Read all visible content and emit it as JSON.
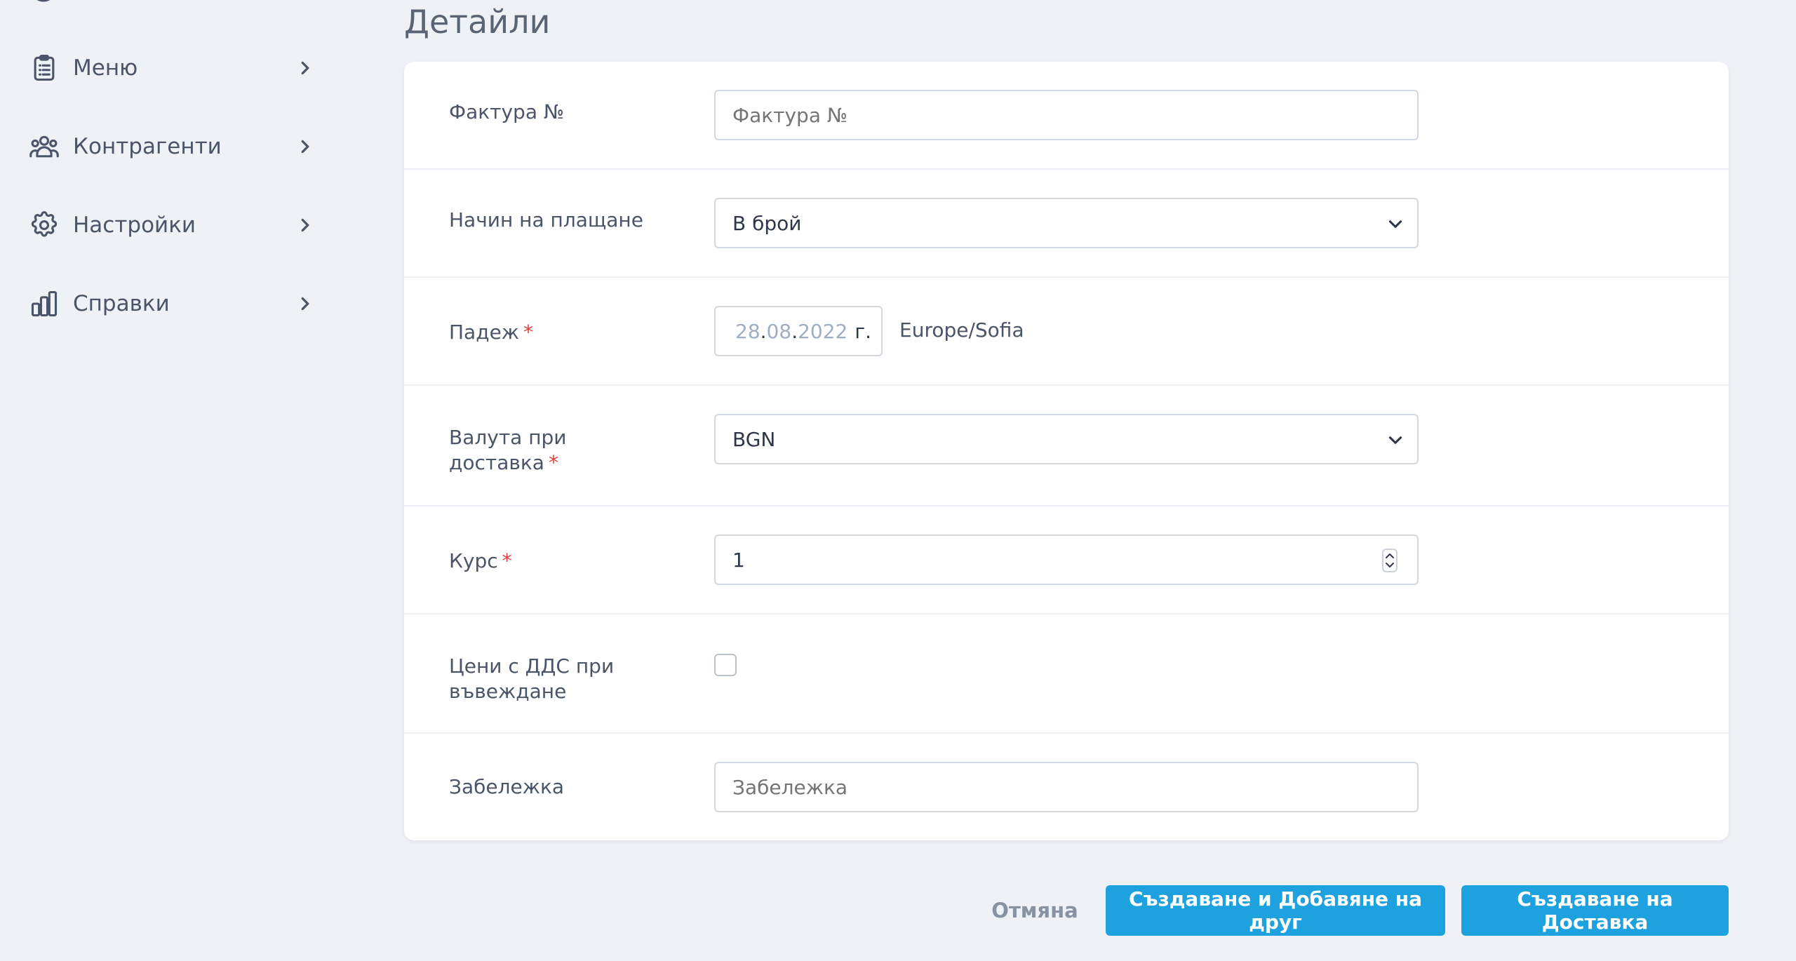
{
  "sidebar": {
    "items": [
      {
        "label": "Меню",
        "icon": "clipboard-list-icon"
      },
      {
        "label": "Контрагенти",
        "icon": "users-icon"
      },
      {
        "label": "Настройки",
        "icon": "gear-icon"
      },
      {
        "label": "Справки",
        "icon": "bar-chart-icon"
      }
    ]
  },
  "page": {
    "title": "Детайли"
  },
  "form": {
    "invoice": {
      "label": "Фактура №",
      "placeholder": "Фактура №",
      "value": ""
    },
    "payment_method": {
      "label": "Начин на плащане",
      "value": "В брой"
    },
    "due_date": {
      "label": "Падеж",
      "required": "*",
      "day": "28",
      "month": "08",
      "year": "2022",
      "suffix": "г.",
      "sep": ".",
      "timezone": "Europe/Sofia"
    },
    "currency": {
      "label_line1": "Валута при",
      "label_line2": "доставка",
      "required": "*",
      "value": "BGN"
    },
    "rate": {
      "label": "Курс",
      "required": "*",
      "value": "1"
    },
    "prices_vat": {
      "label_line1": "Цени с ДДС при",
      "label_line2": "въвеждане",
      "checked": false
    },
    "note": {
      "label": "Забележка",
      "placeholder": "Забележка",
      "value": ""
    }
  },
  "actions": {
    "cancel": "Отмяна",
    "create_and_add": "Създаване и Добавяне на друг",
    "create": "Създаване на Доставка"
  },
  "colors": {
    "accent": "#1ea1df",
    "required": "#e53e3e",
    "background": "#eef2f7"
  }
}
